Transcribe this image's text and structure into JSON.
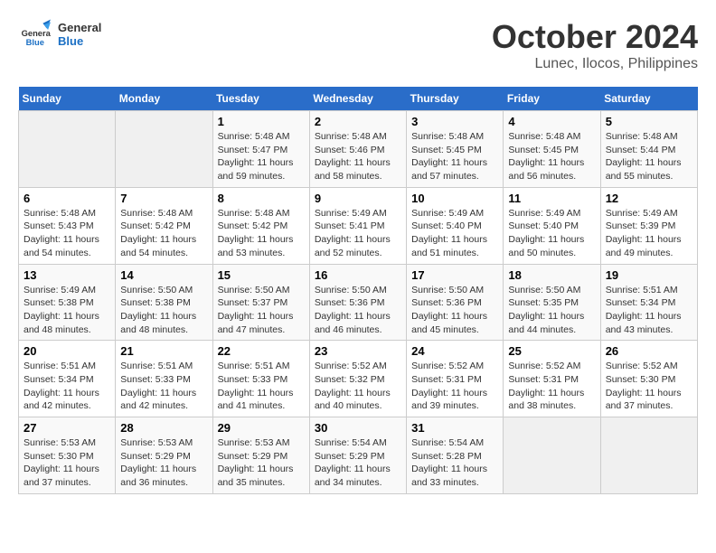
{
  "header": {
    "logo_line1": "General",
    "logo_line2": "Blue",
    "month": "October 2024",
    "location": "Lunec, Ilocos, Philippines"
  },
  "weekdays": [
    "Sunday",
    "Monday",
    "Tuesday",
    "Wednesday",
    "Thursday",
    "Friday",
    "Saturday"
  ],
  "weeks": [
    [
      {
        "day": "",
        "empty": true
      },
      {
        "day": "",
        "empty": true
      },
      {
        "day": "1",
        "sunrise": "5:48 AM",
        "sunset": "5:47 PM",
        "daylight": "11 hours and 59 minutes."
      },
      {
        "day": "2",
        "sunrise": "5:48 AM",
        "sunset": "5:46 PM",
        "daylight": "11 hours and 58 minutes."
      },
      {
        "day": "3",
        "sunrise": "5:48 AM",
        "sunset": "5:45 PM",
        "daylight": "11 hours and 57 minutes."
      },
      {
        "day": "4",
        "sunrise": "5:48 AM",
        "sunset": "5:45 PM",
        "daylight": "11 hours and 56 minutes."
      },
      {
        "day": "5",
        "sunrise": "5:48 AM",
        "sunset": "5:44 PM",
        "daylight": "11 hours and 55 minutes."
      }
    ],
    [
      {
        "day": "6",
        "sunrise": "5:48 AM",
        "sunset": "5:43 PM",
        "daylight": "11 hours and 54 minutes."
      },
      {
        "day": "7",
        "sunrise": "5:48 AM",
        "sunset": "5:42 PM",
        "daylight": "11 hours and 54 minutes."
      },
      {
        "day": "8",
        "sunrise": "5:48 AM",
        "sunset": "5:42 PM",
        "daylight": "11 hours and 53 minutes."
      },
      {
        "day": "9",
        "sunrise": "5:49 AM",
        "sunset": "5:41 PM",
        "daylight": "11 hours and 52 minutes."
      },
      {
        "day": "10",
        "sunrise": "5:49 AM",
        "sunset": "5:40 PM",
        "daylight": "11 hours and 51 minutes."
      },
      {
        "day": "11",
        "sunrise": "5:49 AM",
        "sunset": "5:40 PM",
        "daylight": "11 hours and 50 minutes."
      },
      {
        "day": "12",
        "sunrise": "5:49 AM",
        "sunset": "5:39 PM",
        "daylight": "11 hours and 49 minutes."
      }
    ],
    [
      {
        "day": "13",
        "sunrise": "5:49 AM",
        "sunset": "5:38 PM",
        "daylight": "11 hours and 48 minutes."
      },
      {
        "day": "14",
        "sunrise": "5:50 AM",
        "sunset": "5:38 PM",
        "daylight": "11 hours and 48 minutes."
      },
      {
        "day": "15",
        "sunrise": "5:50 AM",
        "sunset": "5:37 PM",
        "daylight": "11 hours and 47 minutes."
      },
      {
        "day": "16",
        "sunrise": "5:50 AM",
        "sunset": "5:36 PM",
        "daylight": "11 hours and 46 minutes."
      },
      {
        "day": "17",
        "sunrise": "5:50 AM",
        "sunset": "5:36 PM",
        "daylight": "11 hours and 45 minutes."
      },
      {
        "day": "18",
        "sunrise": "5:50 AM",
        "sunset": "5:35 PM",
        "daylight": "11 hours and 44 minutes."
      },
      {
        "day": "19",
        "sunrise": "5:51 AM",
        "sunset": "5:34 PM",
        "daylight": "11 hours and 43 minutes."
      }
    ],
    [
      {
        "day": "20",
        "sunrise": "5:51 AM",
        "sunset": "5:34 PM",
        "daylight": "11 hours and 42 minutes."
      },
      {
        "day": "21",
        "sunrise": "5:51 AM",
        "sunset": "5:33 PM",
        "daylight": "11 hours and 42 minutes."
      },
      {
        "day": "22",
        "sunrise": "5:51 AM",
        "sunset": "5:33 PM",
        "daylight": "11 hours and 41 minutes."
      },
      {
        "day": "23",
        "sunrise": "5:52 AM",
        "sunset": "5:32 PM",
        "daylight": "11 hours and 40 minutes."
      },
      {
        "day": "24",
        "sunrise": "5:52 AM",
        "sunset": "5:31 PM",
        "daylight": "11 hours and 39 minutes."
      },
      {
        "day": "25",
        "sunrise": "5:52 AM",
        "sunset": "5:31 PM",
        "daylight": "11 hours and 38 minutes."
      },
      {
        "day": "26",
        "sunrise": "5:52 AM",
        "sunset": "5:30 PM",
        "daylight": "11 hours and 37 minutes."
      }
    ],
    [
      {
        "day": "27",
        "sunrise": "5:53 AM",
        "sunset": "5:30 PM",
        "daylight": "11 hours and 37 minutes."
      },
      {
        "day": "28",
        "sunrise": "5:53 AM",
        "sunset": "5:29 PM",
        "daylight": "11 hours and 36 minutes."
      },
      {
        "day": "29",
        "sunrise": "5:53 AM",
        "sunset": "5:29 PM",
        "daylight": "11 hours and 35 minutes."
      },
      {
        "day": "30",
        "sunrise": "5:54 AM",
        "sunset": "5:29 PM",
        "daylight": "11 hours and 34 minutes."
      },
      {
        "day": "31",
        "sunrise": "5:54 AM",
        "sunset": "5:28 PM",
        "daylight": "11 hours and 33 minutes."
      },
      {
        "day": "",
        "empty": true
      },
      {
        "day": "",
        "empty": true
      }
    ]
  ],
  "labels": {
    "sunrise": "Sunrise:",
    "sunset": "Sunset:",
    "daylight": "Daylight:"
  }
}
